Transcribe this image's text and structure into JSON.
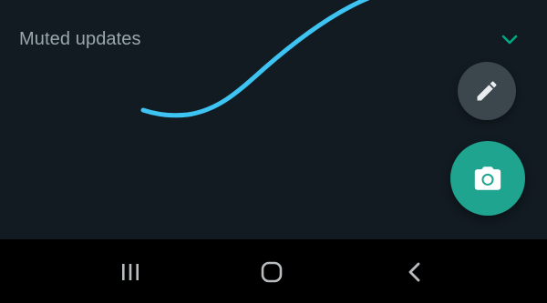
{
  "status_section": {
    "muted_label": "Muted updates",
    "expand_icon": "chevron-down-icon"
  },
  "fabs": {
    "edit_icon": "pencil-icon",
    "camera_icon": "camera-icon"
  },
  "nav_bar": {
    "recents_icon": "recents-icon",
    "home_icon": "home-icon",
    "back_icon": "back-icon"
  },
  "colors": {
    "background": "#121b22",
    "label_text": "#9aa6ad",
    "accent": "#00a884",
    "camera_fab": "#1fa490",
    "edit_fab": "#3b464d",
    "annotation_stroke": "#3ec4f2",
    "nav_background": "#000000"
  }
}
